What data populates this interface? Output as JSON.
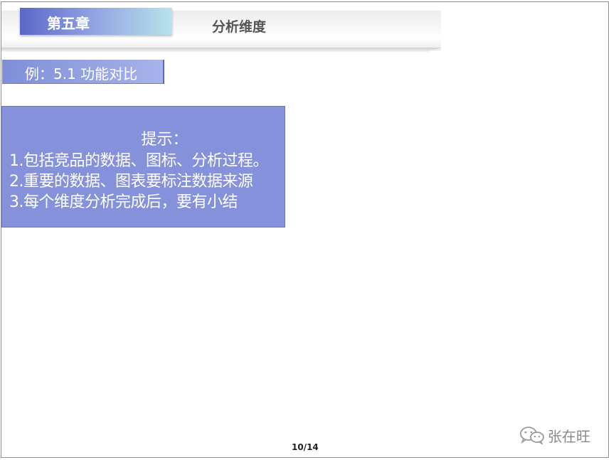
{
  "header": {
    "chapter": "第五章",
    "section_title": "分析维度"
  },
  "example": {
    "label": "例：5.1 功能对比"
  },
  "tips": {
    "title": "提示：",
    "lines": [
      "1.包括竞品的数据、图标、分析过程。",
      "2.重要的数据、图表要标注数据来源",
      "3.每个维度分析完成后，要有小结"
    ]
  },
  "footer": {
    "page": "10/14"
  },
  "watermark": {
    "text": "张在旺",
    "icon": "wechat-icon"
  },
  "colors": {
    "accent": "#8591da",
    "tab_start": "#5c68c7",
    "tab_end": "#b8e4ec"
  }
}
